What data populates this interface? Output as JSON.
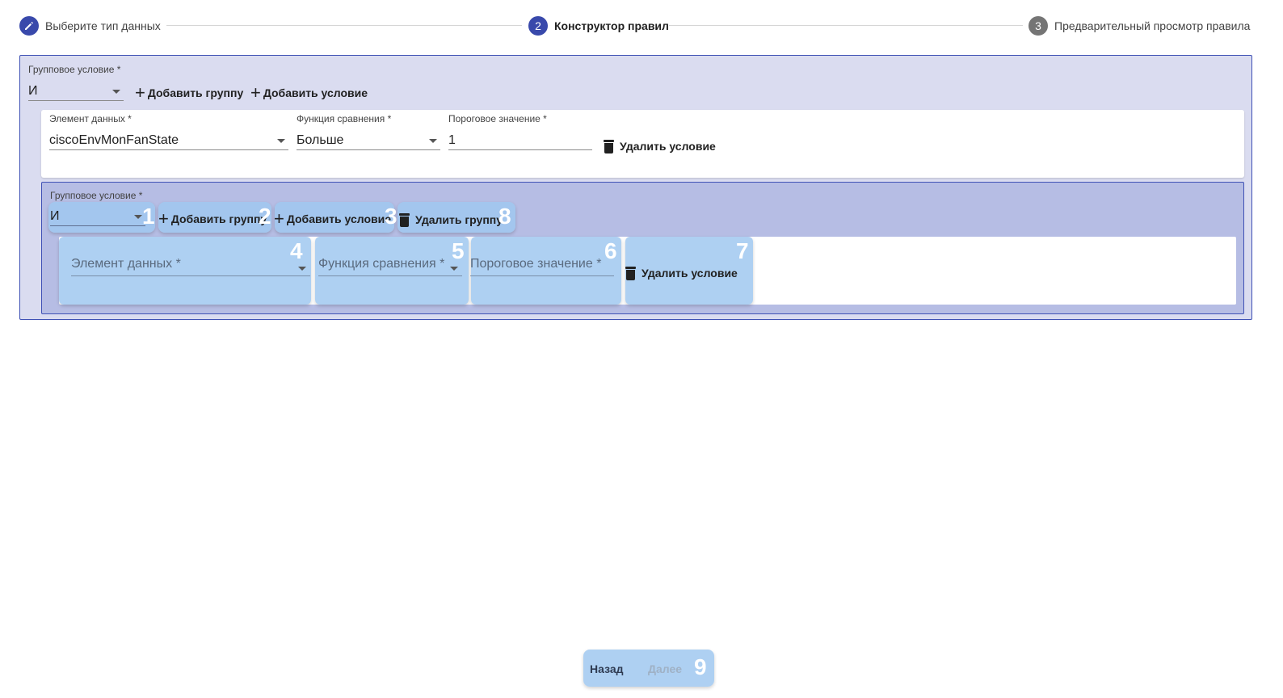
{
  "stepper": {
    "step1_label": "Выберите тип данных",
    "step2_number": "2",
    "step2_label": "Конструктор правил",
    "step3_number": "3",
    "step3_label": "Предварительный просмотр правила"
  },
  "outer_group": {
    "condition_label": "Групповое условие *",
    "condition_value": "И",
    "add_group": "Добавить группу",
    "add_condition": "Добавить условие",
    "condition": {
      "data_element_label": "Элемент данных *",
      "data_element_value": "ciscoEnvMonFanState",
      "compare_function_label": "Функция сравнения *",
      "compare_function_value": "Больше",
      "threshold_label": "Пороговое значение *",
      "threshold_value": "1",
      "delete_condition": "Удалить условие"
    }
  },
  "inner_group": {
    "condition_label": "Групповое условие *",
    "condition_value": "И",
    "add_group": "Добавить группу",
    "add_condition": "Добавить условие",
    "delete_group": "Удалить группу",
    "condition": {
      "data_element_placeholder": "Элемент данных *",
      "compare_function_placeholder": "Функция сравнения *",
      "threshold_placeholder": "Пороговое значение *",
      "delete_condition": "Удалить условие"
    }
  },
  "footer": {
    "back": "Назад",
    "next": "Далее"
  },
  "markers": [
    "1",
    "2",
    "3",
    "4",
    "5",
    "6",
    "7",
    "8",
    "9"
  ],
  "colors": {
    "accent": "#3949ab",
    "group_bg": "#dadcf0",
    "inner_group_bg": "#b6bde4",
    "highlight": "#a0c8f0",
    "disabled_text": "#9fb1c5"
  }
}
